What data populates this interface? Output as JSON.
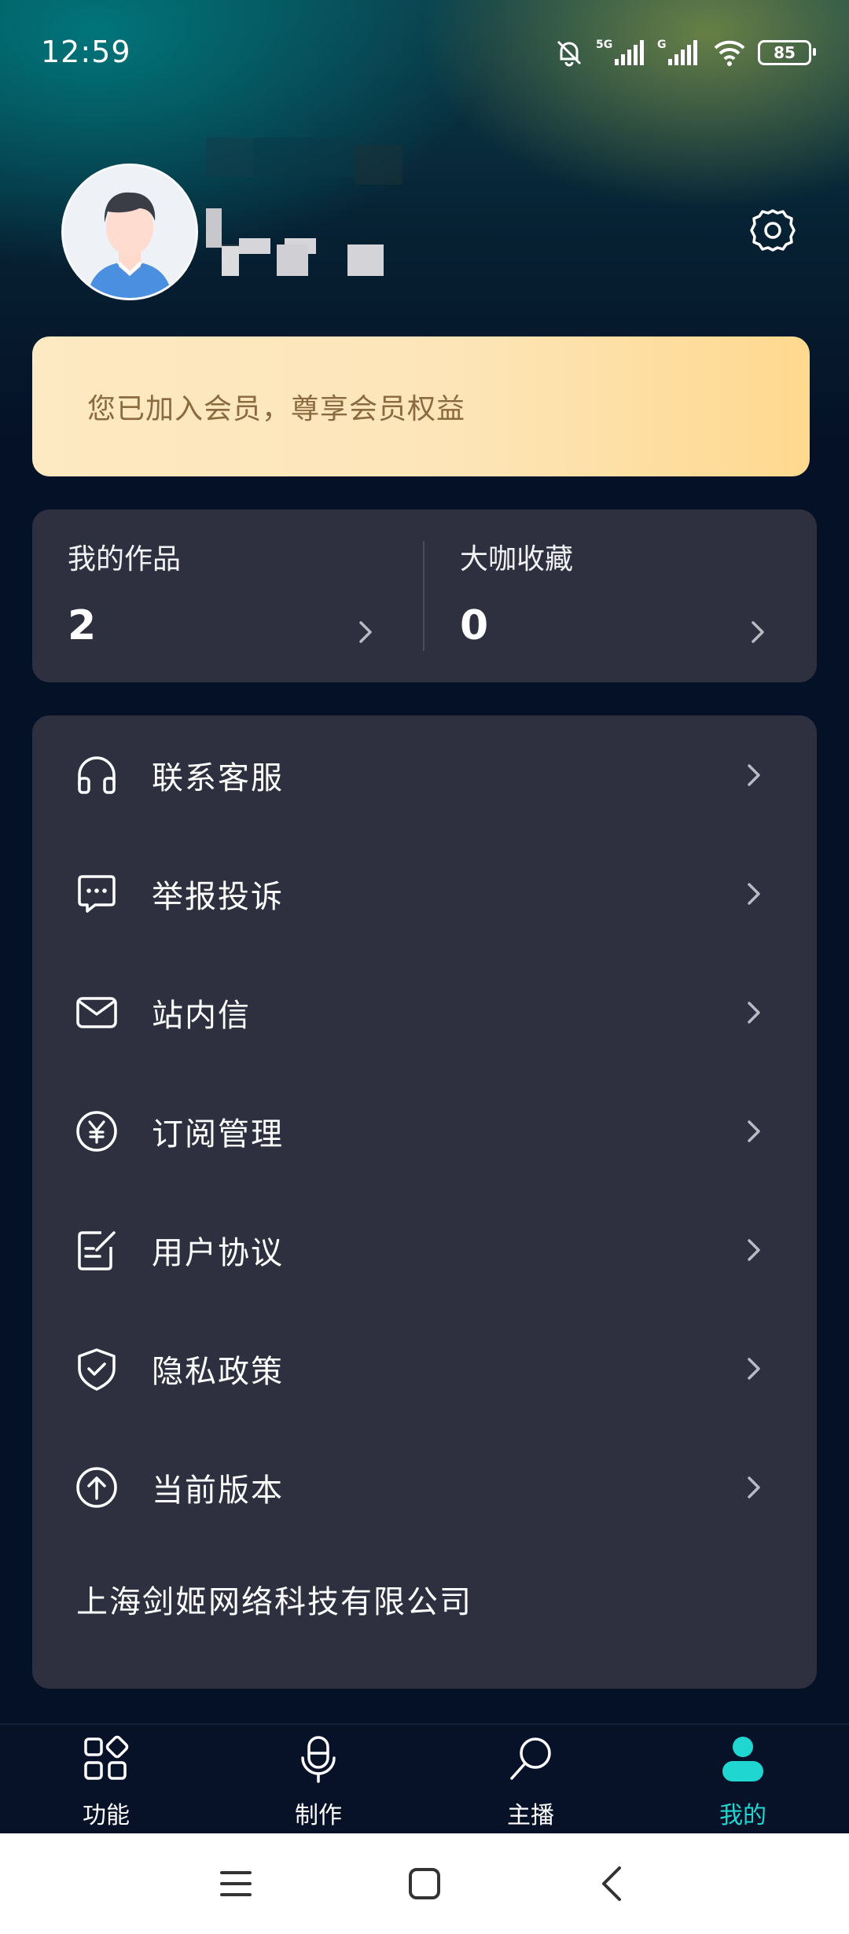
{
  "status_bar": {
    "time": "12:59",
    "battery": "85",
    "icons": [
      "bell-mute-icon",
      "5g-signal-icon",
      "g-signal-icon",
      "wifi-icon",
      "battery-icon"
    ]
  },
  "profile": {
    "avatar": "avatar-icon",
    "settings_icon": "gear-icon"
  },
  "vip": {
    "text": "您已加入会员，尊享会员权益"
  },
  "stats": [
    {
      "label": "我的作品",
      "value": "2"
    },
    {
      "label": "大咖收藏",
      "value": "0"
    }
  ],
  "menu": {
    "items": [
      {
        "label": "联系客服",
        "icon": "headset-icon"
      },
      {
        "label": "举报投诉",
        "icon": "chat-bubble-icon"
      },
      {
        "label": "站内信",
        "icon": "mail-icon"
      },
      {
        "label": "订阅管理",
        "icon": "yuan-icon"
      },
      {
        "label": "用户协议",
        "icon": "document-edit-icon"
      },
      {
        "label": "隐私政策",
        "icon": "shield-check-icon"
      },
      {
        "label": "当前版本",
        "icon": "arrow-up-circle-icon"
      }
    ],
    "company": "上海剑姬网络科技有限公司"
  },
  "tabs": [
    {
      "label": "功能",
      "icon": "grid-icon",
      "active": false
    },
    {
      "label": "制作",
      "icon": "microphone-icon",
      "active": false
    },
    {
      "label": "主播",
      "icon": "search-icon",
      "active": false
    },
    {
      "label": "我的",
      "icon": "person-icon",
      "active": true
    }
  ],
  "colors": {
    "background": "#051127",
    "card": "#2e3040",
    "vip_gold": "#fed98e",
    "vip_text": "#8a6a3e",
    "accent": "#1fd6d0"
  }
}
